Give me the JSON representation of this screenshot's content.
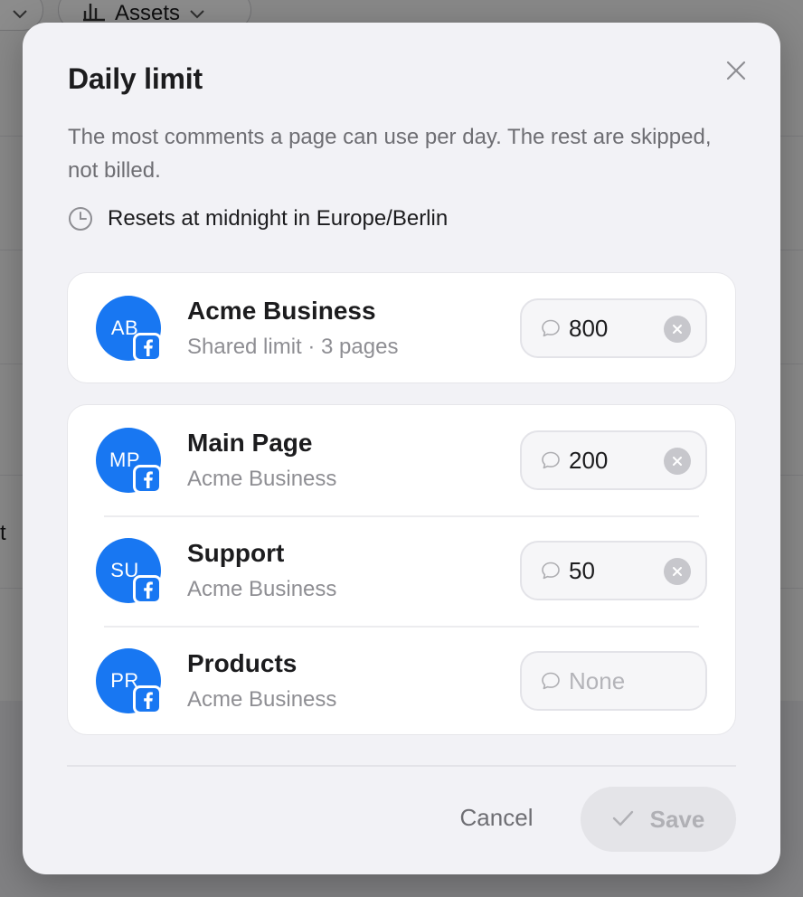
{
  "background": {
    "assets_label": "Assets",
    "partial_text": "t"
  },
  "modal": {
    "title": "Daily limit",
    "description": "The most comments a page can use per day. The rest are skipped, not billed.",
    "reset_note": "Resets at midnight in Europe/Berlin"
  },
  "business": {
    "initials": "AB",
    "name": "Acme Business",
    "subtitle": "Shared limit · 3 pages",
    "limit": "800"
  },
  "pages": [
    {
      "initials": "MP",
      "name": "Main Page",
      "subtitle": "Acme Business",
      "limit": "200"
    },
    {
      "initials": "SU",
      "name": "Support",
      "subtitle": "Acme Business",
      "limit": "50"
    },
    {
      "initials": "PR",
      "name": "Products",
      "subtitle": "Acme Business",
      "limit": "",
      "placeholder": "None"
    }
  ],
  "footer": {
    "cancel_label": "Cancel",
    "save_label": "Save"
  },
  "colors": {
    "facebook_blue": "#1877f2",
    "modal_bg": "#f2f2f6",
    "save_disabled_bg": "#e4e4e8"
  },
  "icons": {
    "close": "close-icon",
    "clock": "clock-icon",
    "comment": "comment-bubble-icon",
    "clear": "clear-icon",
    "facebook": "facebook-icon",
    "check": "checkmark-icon",
    "chart": "bar-chart-icon",
    "chevron": "chevron-down-icon"
  }
}
